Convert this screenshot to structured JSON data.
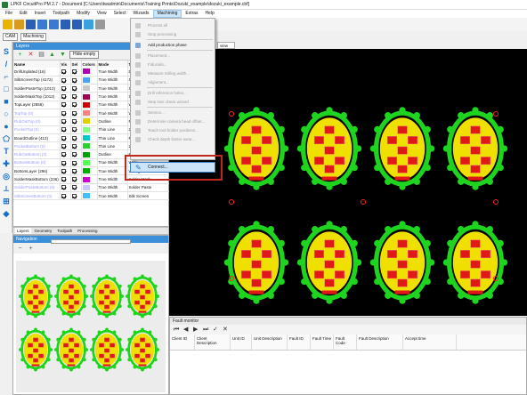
{
  "window": {
    "title": "LPKF CircuitPro PM 2.7 - Document [C:\\Users\\twadmin\\Documents\\Training Prints\\Dozuki_example\\dozuki_example.cbf]"
  },
  "menubar": [
    "File",
    "Edit",
    "Insert",
    "Toolpath",
    "Modify",
    "View",
    "Select",
    "Wizards",
    "Machining",
    "Extras",
    "Help"
  ],
  "toolbar2": {
    "mode": "CAM",
    "sub": "Machining"
  },
  "layers": {
    "title": "Layers",
    "hide_empty": "Hide empty",
    "columns": [
      "Name",
      "Vis",
      "Sel",
      "Colors",
      "Mode",
      "Tech"
    ],
    "rows": [
      {
        "name": "DrillUnplated (16)",
        "mode": "True Width",
        "tech": "Drill",
        "color": "#b400b4",
        "dim": false
      },
      {
        "name": "SilkScreenTop (4172)",
        "mode": "True Width",
        "tech": "Silk Scr",
        "color": "#4aa4ff",
        "dim": false
      },
      {
        "name": "SolderPasteTop (1012)",
        "mode": "True Width",
        "tech": "Solder",
        "color": "#c8c8c8",
        "dim": false
      },
      {
        "name": "SolderMaskTop (1012)",
        "mode": "True Width",
        "tech": "Solder",
        "color": "#a00050",
        "dim": false
      },
      {
        "name": "TopLayer (2856)",
        "mode": "True Width",
        "tech": "Wirin",
        "color": "#d00000",
        "dim": false
      },
      {
        "name": "TopTop (0)",
        "mode": "True Width",
        "tech": "Wirin",
        "color": "#ff8080",
        "dim": true
      },
      {
        "name": "RubOutTop (0)",
        "mode": "Outline",
        "tech": "RubOut",
        "color": "#e0d000",
        "dim": true
      },
      {
        "name": "PocketTop (0)",
        "mode": "Thin Line",
        "tech": "2.5D",
        "color": "#80ff80",
        "dim": true
      },
      {
        "name": "BoardOutline (412)",
        "mode": "Thin Line",
        "tech": "Mech",
        "color": "#00c8c8",
        "dim": false
      },
      {
        "name": "PocketBottom (0)",
        "mode": "Thin Line",
        "tech": "2.5D",
        "color": "#2ad02a",
        "dim": true
      },
      {
        "name": "RubOutBottom (0)",
        "mode": "Outline",
        "tech": "RubOut",
        "color": "#00a000",
        "dim": true
      },
      {
        "name": "BottomBottom (0)",
        "mode": "True Width",
        "tech": "Wirin",
        "color": "#50ff50",
        "dim": true
      },
      {
        "name": "BottomLayer (296)",
        "mode": "True Width",
        "tech": "Wiring",
        "color": "#00b000",
        "dim": false
      },
      {
        "name": "SolderMaskBottom (236)",
        "mode": "True Width",
        "tech": "Solder Mask",
        "color": "#d000d0",
        "dim": false
      },
      {
        "name": "SolderPasteBottom (0)",
        "mode": "True Width",
        "tech": "Solder Paste",
        "color": "#c8c8ff",
        "dim": true
      },
      {
        "name": "SilkScreenBottom (0)",
        "mode": "True Width",
        "tech": "Silk Screen",
        "color": "#40c0ff",
        "dim": true
      }
    ]
  },
  "tabs": [
    "Layers",
    "Geometry",
    "Toolpath",
    "Processing"
  ],
  "navigation": {
    "title": "Navigation"
  },
  "canvas_tab": "view",
  "fault": {
    "title": "Fault monitor",
    "columns": [
      "Client ID",
      "Client Description",
      "Unit ID",
      "Unit Description",
      "Fault ID",
      "Fault Time",
      "Fault Code",
      "Fault Description",
      "Accept time"
    ]
  },
  "machining_menu": {
    "items": [
      {
        "label": "Process all",
        "disabled": true
      },
      {
        "label": "Stop processing",
        "disabled": true
      },
      {
        "label": "Add production phase",
        "disabled": false
      },
      {
        "label": "Placement...",
        "disabled": true
      },
      {
        "label": "Fiducials...",
        "disabled": true
      },
      {
        "label": "Measure milling width...",
        "disabled": true
      },
      {
        "label": "Alignment...",
        "disabled": true
      },
      {
        "label": "Drill reference holes...",
        "disabled": true
      },
      {
        "label": "Step loss check wizard",
        "disabled": true
      },
      {
        "label": "Service...",
        "disabled": true
      },
      {
        "label": "Determine camera head offset...",
        "disabled": true
      },
      {
        "label": "Teach tool holder positions...",
        "disabled": true
      },
      {
        "label": "Check depth limiter wear...",
        "disabled": true
      }
    ],
    "connect": "Connect..."
  },
  "colors": {
    "accent": "#3a8fd8",
    "highlight": "#c0281e",
    "board_green": "#1ed41e",
    "pad_yellow": "#f0e000",
    "pad_red": "#e01818"
  }
}
